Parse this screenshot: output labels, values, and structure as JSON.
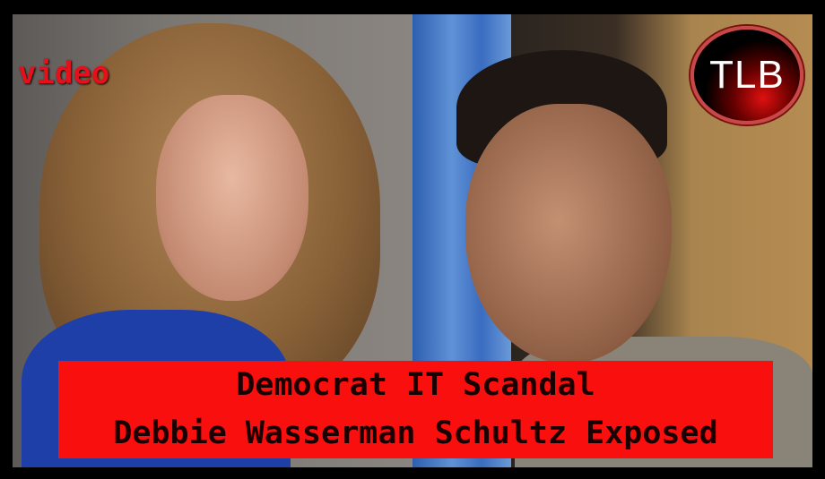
{
  "video_label": "video",
  "logo": {
    "text": "TLB"
  },
  "banner": {
    "line1": "Democrat IT Scandal",
    "line2": "Debbie Wasserman Schultz Exposed"
  },
  "colors": {
    "banner": "#fa0f0f",
    "video_label": "#e5101a",
    "frame": "#000000"
  }
}
